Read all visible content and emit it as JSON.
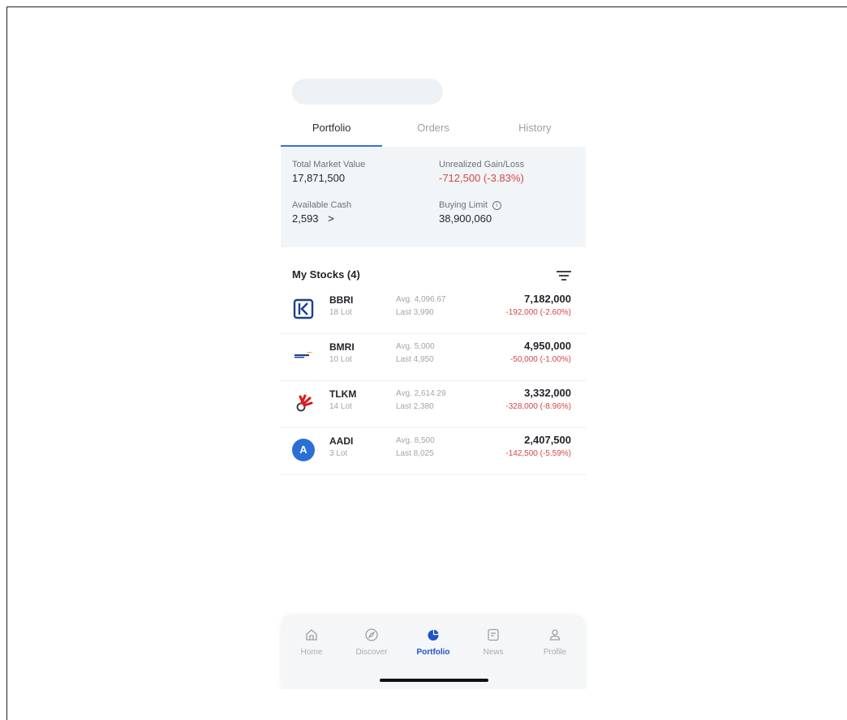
{
  "tabs": [
    {
      "label": "Portfolio",
      "active": true
    },
    {
      "label": "Orders",
      "active": false
    },
    {
      "label": "History",
      "active": false
    }
  ],
  "summary": {
    "total_market_value_label": "Total Market Value",
    "total_market_value": "17,871,500",
    "unrealized_label": "Unrealized Gain/Loss",
    "unrealized_value": "-712,500 (-3.83%)",
    "available_cash_label": "Available Cash",
    "available_cash": "2,593",
    "available_cash_chevron": ">",
    "buying_limit_label": "Buying Limit",
    "buying_limit": "38,900,060"
  },
  "stocks_header": "My Stocks (4)",
  "stocks": [
    {
      "ticker": "BBRI",
      "lot": "18 Lot",
      "avg": "Avg. 4,096.67",
      "last": "Last 3,990",
      "market_value": "7,182,000",
      "change": "-192,000 (-2.60%)",
      "logo": "bbri-logo"
    },
    {
      "ticker": "BMRI",
      "lot": "10 Lot",
      "avg": "Avg. 5,000",
      "last": "Last 4,950",
      "market_value": "4,950,000",
      "change": "-50,000 (-1.00%)",
      "logo": "mandiri-logo"
    },
    {
      "ticker": "TLKM",
      "lot": "14 Lot",
      "avg": "Avg. 2,614.29",
      "last": "Last 2,380",
      "market_value": "3,332,000",
      "change": "-328,000 (-8.96%)",
      "logo": "telkom-logo"
    },
    {
      "ticker": "AADI",
      "lot": "3 Lot",
      "avg": "Avg. 8,500",
      "last": "Last 8,025",
      "market_value": "2,407,500",
      "change": "-142,500 (-5.59%)",
      "logo": "aadi-logo",
      "logo_letter": "A"
    }
  ],
  "nav": [
    {
      "label": "Home",
      "icon": "home-icon"
    },
    {
      "label": "Discover",
      "icon": "compass-icon"
    },
    {
      "label": "Portfolio",
      "icon": "pie-chart-icon",
      "active": true
    },
    {
      "label": "News",
      "icon": "news-icon"
    },
    {
      "label": "Profile",
      "icon": "user-icon"
    }
  ],
  "colors": {
    "accent": "#1d55c9",
    "negative": "#d64545",
    "summary_bg": "#f2f5f8"
  }
}
